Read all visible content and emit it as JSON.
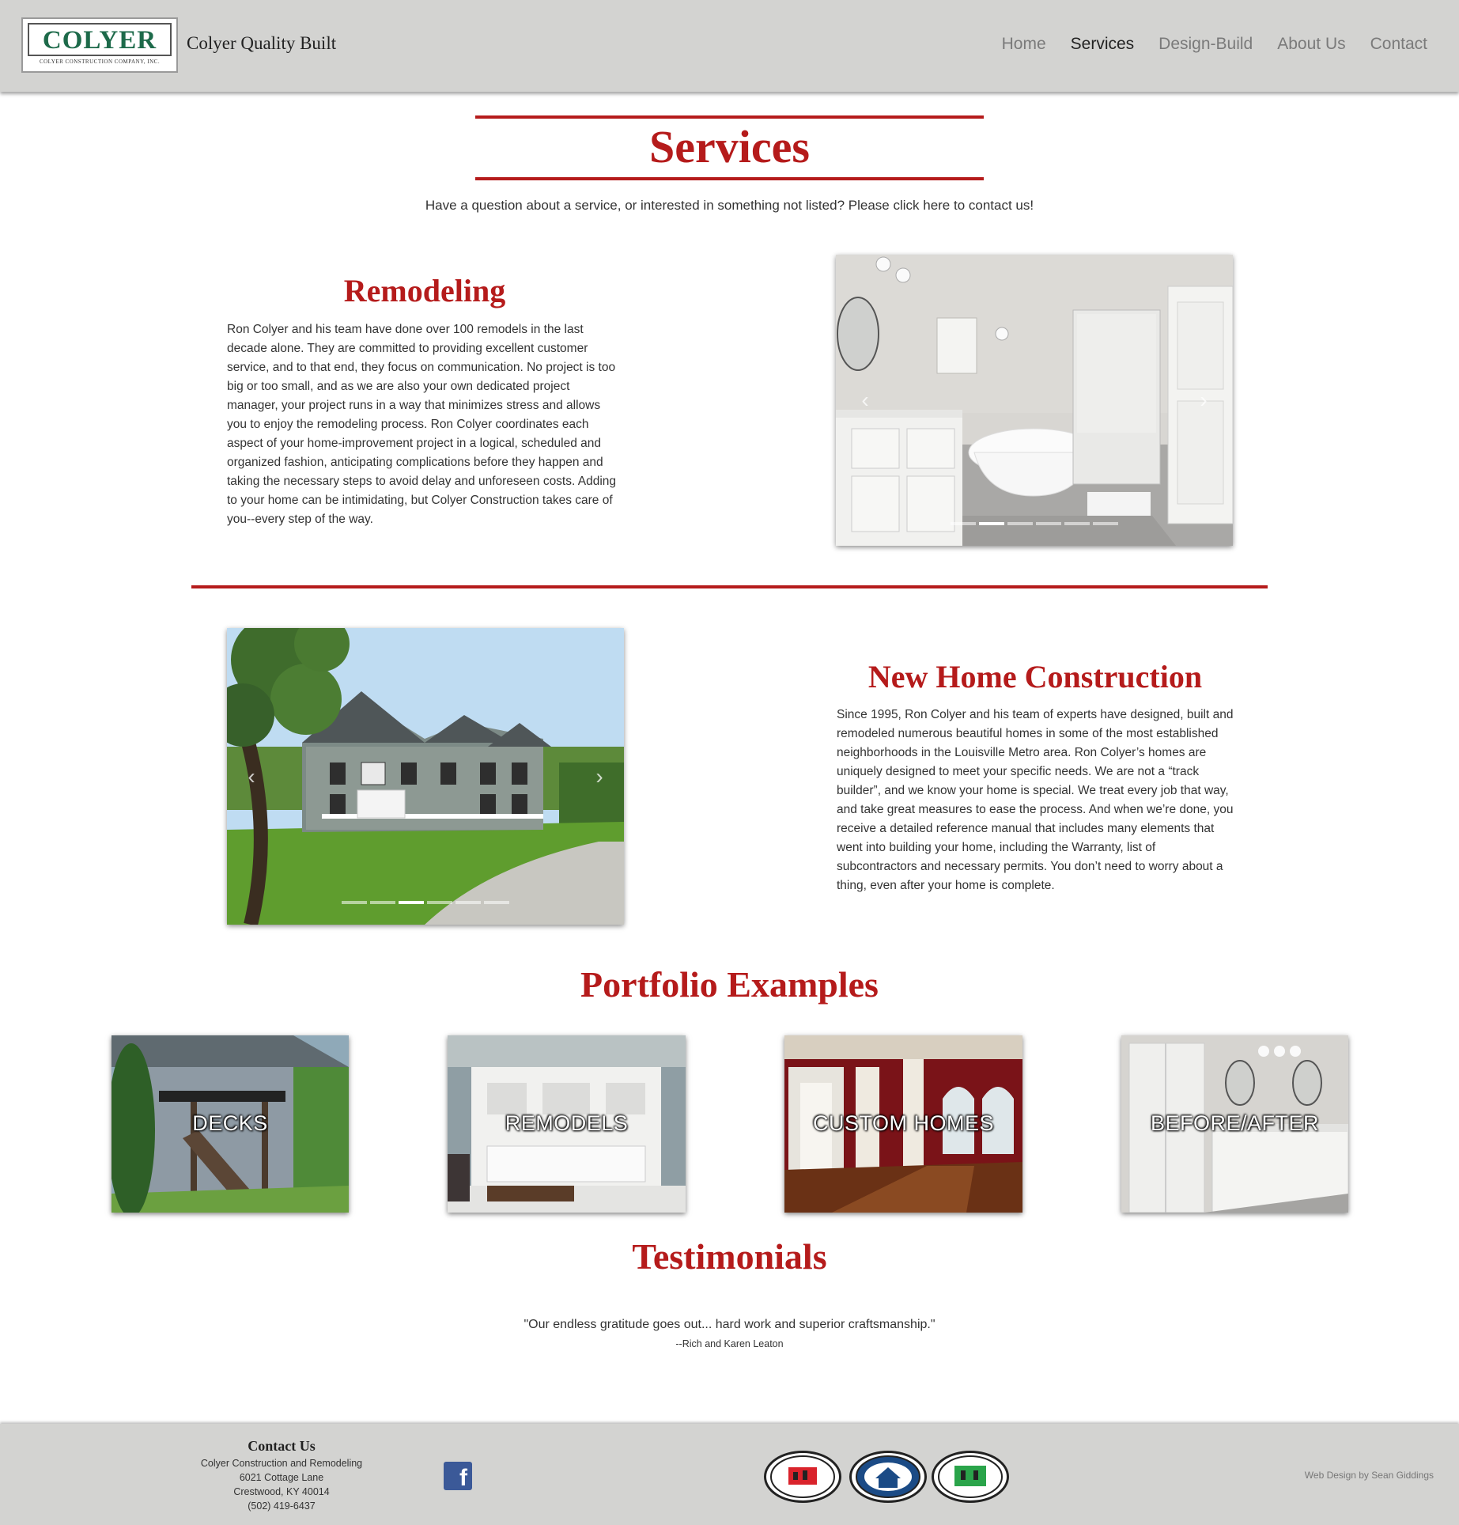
{
  "header": {
    "logo_word": "COLYER",
    "logo_sub": "COLYER CONSTRUCTION COMPANY, INC.",
    "site_title": "Colyer Quality Built",
    "nav": [
      "Home",
      "Services",
      "Design-Build",
      "About Us",
      "Contact"
    ],
    "active_nav": "Services"
  },
  "page": {
    "title": "Services",
    "intro_before": "Have a question about a service, or interested in something not listed? Please click ",
    "intro_link": "here",
    "intro_after": " to contact us!"
  },
  "remodeling": {
    "heading": "Remodeling",
    "body": "Ron Colyer and his team have done over 100 remodels in the last decade alone. They are committed to providing excellent customer service, and to that end, they focus on communication. No project is too big or too small, and as we are also your own dedicated project manager, your project runs in a way that minimizes stress and allows you to enjoy the remodeling process. Ron Colyer coordinates each aspect of your home-improvement project in a logical, scheduled and organized fashion, anticipating complications before they happen and taking the necessary steps to avoid delay and unforeseen costs. Adding to your home can be intimidating, but Colyer Construction takes care of you--every step of the way.",
    "carousel_slides": 6,
    "carousel_active": 1
  },
  "new_home": {
    "heading": "New Home Construction",
    "body": "Since 1995, Ron Colyer and his team of experts have designed, built and remodeled numerous beautiful homes in some of the most established neighborhoods in the Louisville Metro area. Ron Colyer’s homes are uniquely designed to meet your specific needs. We are not a “track builder”, and we know your home is special. We treat every job that way, and take great measures to ease the process. And when we’re done, you receive a detailed reference manual that includes many elements that went into building your home, including the Warranty, list of subcontractors and necessary permits. You don’t need to worry about a thing, even after your home is complete.",
    "carousel_slides": 6,
    "carousel_active": 2
  },
  "portfolio": {
    "title": "Portfolio Examples",
    "tiles": [
      "DECKS",
      "REMODELS",
      "CUSTOM HOMES",
      "BEFORE/AFTER"
    ]
  },
  "testimonials": {
    "title": "Testimonials",
    "quote": "\"Our endless gratitude goes out... hard work and superior craftsmanship.\"",
    "author": "--Rich and Karen Leaton"
  },
  "footer": {
    "contact_heading": "Contact Us",
    "company": "Colyer Construction and Remodeling",
    "address1": "6021 Cottage Lane",
    "address2": "Crestwood, KY 40014",
    "phone": "(502) 419-6437",
    "facebook_icon": "facebook-icon",
    "credit": "Web Design by Sean Giddings"
  },
  "colors": {
    "accent": "#b51b1b",
    "header_bg": "#d3d3d1",
    "logo_green": "#1d6a4a",
    "facebook": "#3b5998"
  }
}
